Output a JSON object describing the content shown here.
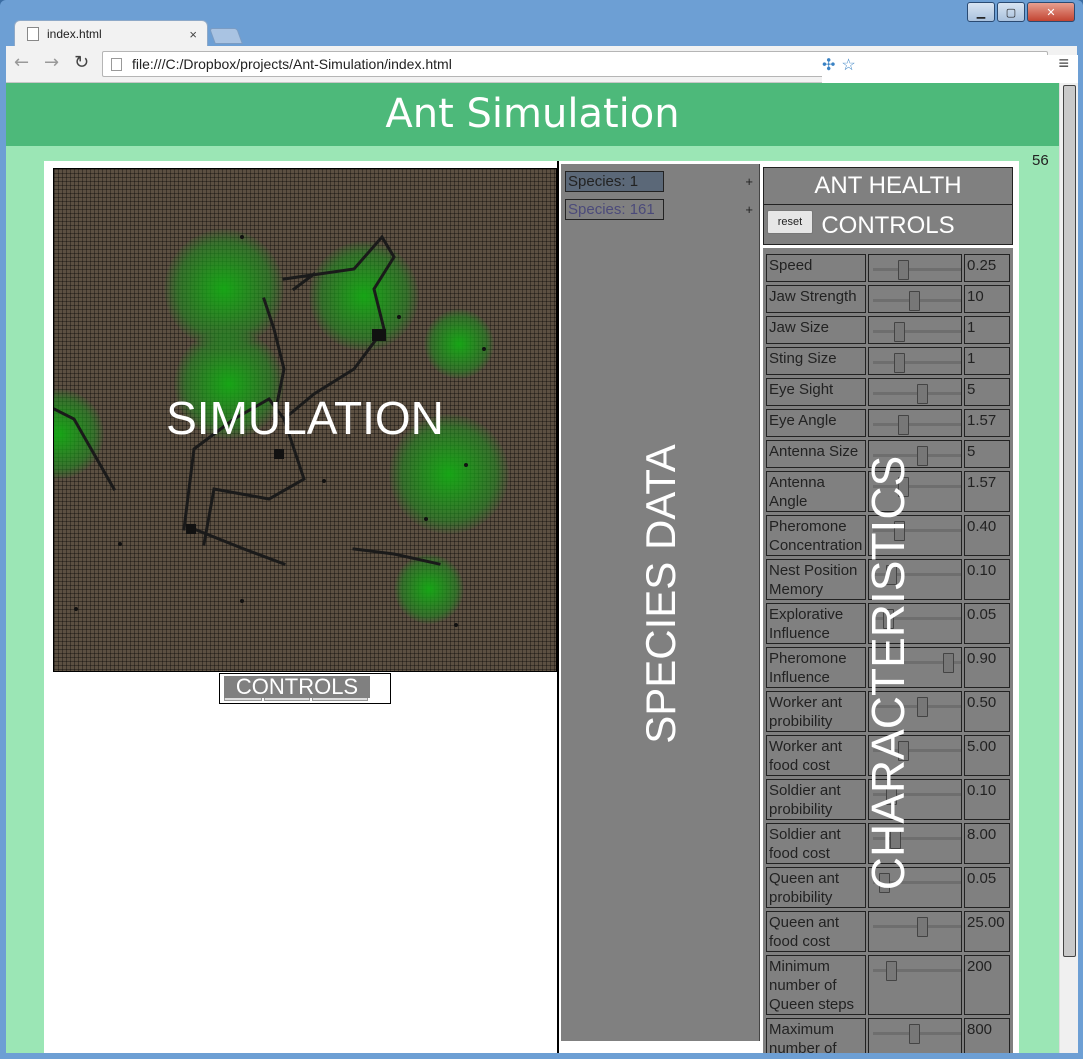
{
  "window": {
    "minimize": "▁",
    "maximize": "▢",
    "close": "✕"
  },
  "tab": {
    "title": "index.html",
    "close": "×"
  },
  "toolbar": {
    "back": "←",
    "forward": "→",
    "reload": "↻",
    "url": "file:///C:/Dropbox/projects/Ant-Simulation/index.html",
    "ext_icons": "✣☆",
    "menu": "≡"
  },
  "page": {
    "title": "Ant Simulation",
    "counter": "56",
    "simulation_label": "SIMULATION",
    "controls_label": "CONTROLS",
    "species_label": "SPECIES DATA",
    "species": [
      {
        "label": "Species: 1",
        "plus": "+"
      },
      {
        "label": "Species: 161",
        "plus": "+"
      }
    ],
    "health": {
      "title": "ANT HEALTH",
      "controls": "CONTROLS",
      "reset_label": "reset"
    },
    "characteristics_label": "CHARACTERISTICS",
    "characteristics": [
      {
        "name": "Speed",
        "value": "0.25",
        "level": 0.3
      },
      {
        "name": "Jaw Strength",
        "value": "10",
        "level": 0.45
      },
      {
        "name": "Jaw Size",
        "value": "1",
        "level": 0.25
      },
      {
        "name": "Sting Size",
        "value": "1",
        "level": 0.25
      },
      {
        "name": "Eye Sight",
        "value": "5",
        "level": 0.55
      },
      {
        "name": "Eye Angle",
        "value": "1.57",
        "level": 0.3
      },
      {
        "name": "Antenna Size",
        "value": "5",
        "level": 0.55
      },
      {
        "name": "Antenna Angle",
        "value": "1.57",
        "level": 0.3
      },
      {
        "name": "Pheromone Concentration",
        "value": "0.40",
        "level": 0.25
      },
      {
        "name": "Nest Position Memory",
        "value": "0.10",
        "level": 0.15
      },
      {
        "name": "Explorative Influence",
        "value": "0.05",
        "level": 0.1
      },
      {
        "name": "Pheromone Influence",
        "value": "0.90",
        "level": 0.9
      },
      {
        "name": "Worker ant probibility",
        "value": "0.50",
        "level": 0.55
      },
      {
        "name": "Worker ant food cost",
        "value": "5.00",
        "level": 0.3
      },
      {
        "name": "Soldier ant probibility",
        "value": "0.10",
        "level": 0.15
      },
      {
        "name": "Soldier ant food cost",
        "value": "8.00",
        "level": 0.2
      },
      {
        "name": "Queen ant probibility",
        "value": "0.05",
        "level": 0.05
      },
      {
        "name": "Queen ant food cost",
        "value": "25.00",
        "level": 0.55
      },
      {
        "name": "Minimum number of Queen steps",
        "value": "200",
        "level": 0.15
      },
      {
        "name": "Maximum number of",
        "value": "800",
        "level": 0.45
      }
    ]
  }
}
